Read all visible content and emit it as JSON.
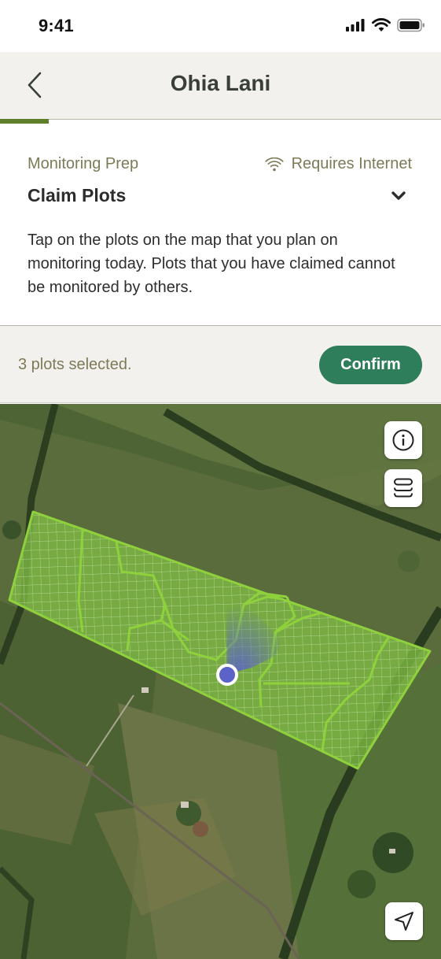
{
  "status_bar": {
    "time": "9:41"
  },
  "header": {
    "title": "Ohia Lani",
    "progress": 0.11
  },
  "step": {
    "section": "Monitoring Prep",
    "connectivity": "Requires Internet",
    "title": "Claim Plots",
    "instructions": "Tap on the plots on the map that you plan on monitoring today. Plots that you have claimed cannot be monitored by others."
  },
  "selection": {
    "summary": "3 plots selected.",
    "confirm_label": "Confirm"
  },
  "colors": {
    "brand_green": "#2e7d5b",
    "progress_green": "#5f7f2a",
    "plot_outline": "#8ed13c",
    "location_dot": "#5b63c9",
    "muted_text": "#7d7a58"
  },
  "icons": {
    "back": "chevron-left-icon",
    "wifi": "wifi-icon",
    "expand": "chevron-down-icon",
    "info": "info-icon",
    "layers": "layers-icon",
    "locate": "navigation-arrow-icon"
  }
}
